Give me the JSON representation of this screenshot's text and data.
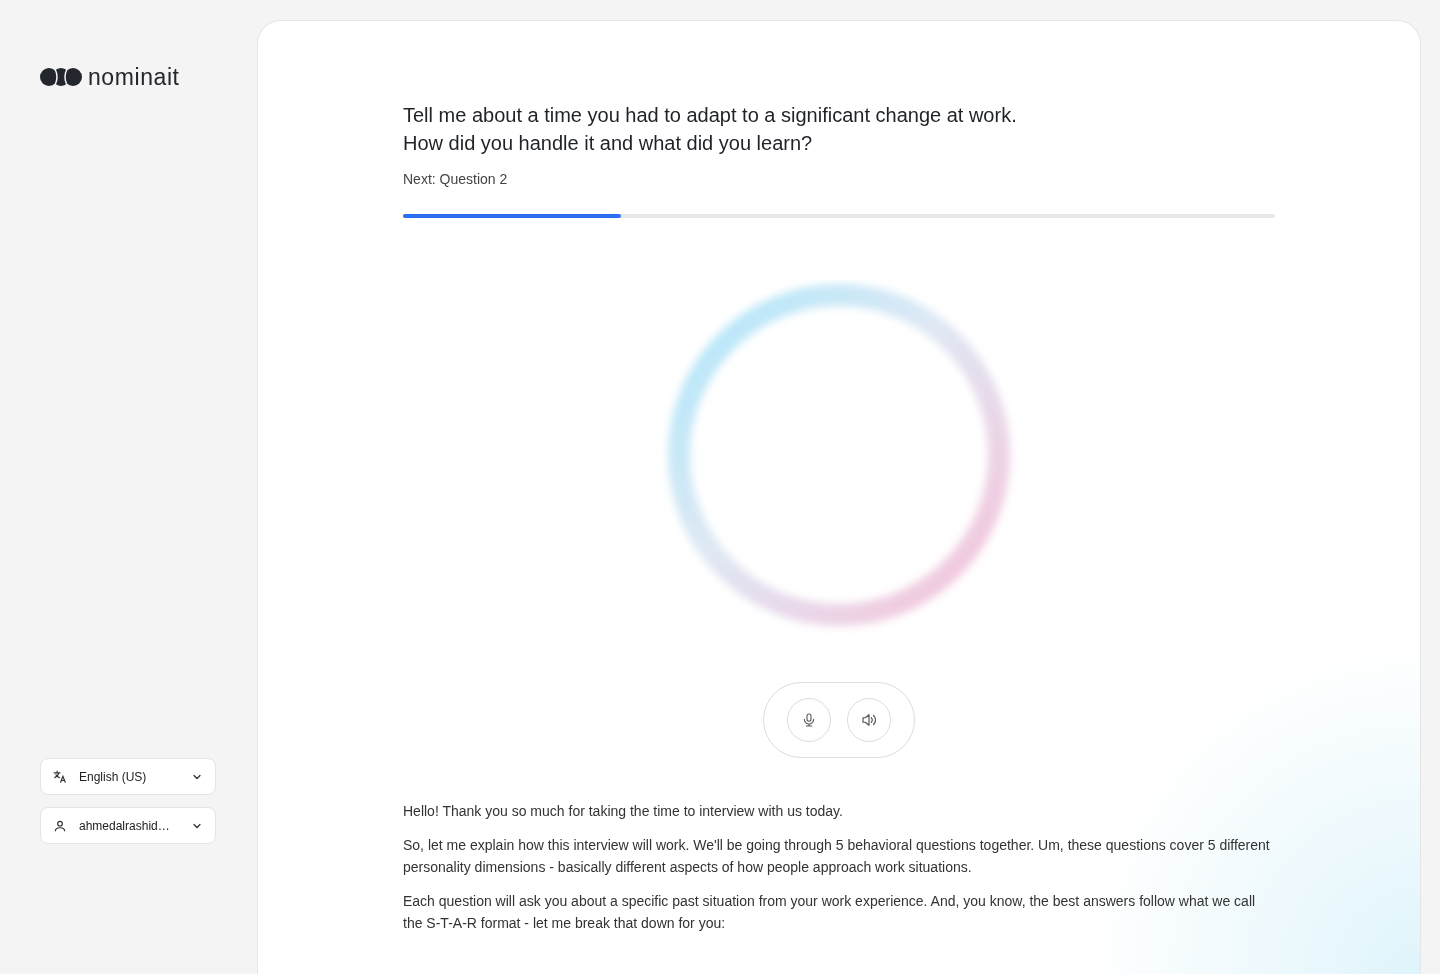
{
  "brand": {
    "name": "nominait"
  },
  "question": {
    "lines": [
      "Tell me about a time you had to adapt to a significant change at work.",
      "How did you handle it and what did you learn?"
    ],
    "next": "Next: Question 2",
    "progress": {
      "level": 0.25
    }
  },
  "controls": [
    {
      "kind": "mic"
    },
    {
      "kind": "speaker"
    }
  ],
  "transcript": [
    "Hello! Thank you so much for taking the time to interview with us today.",
    "So, let me explain how this interview will work. We'll be going through 5 behavioral questions together. Um, these questions cover 5 different personality dimensions - basically different aspects of how people approach work situations.",
    "Each question will ask you about a specific past situation from your work experience. And, you know, the best answers follow what we call the S-T-A-R format - let me break that down for you:"
  ],
  "sidebar": {
    "selects": [
      {
        "kind": "language",
        "value": "English (US)"
      },
      {
        "kind": "user",
        "value": "ahmedalrashid…"
      }
    ]
  }
}
